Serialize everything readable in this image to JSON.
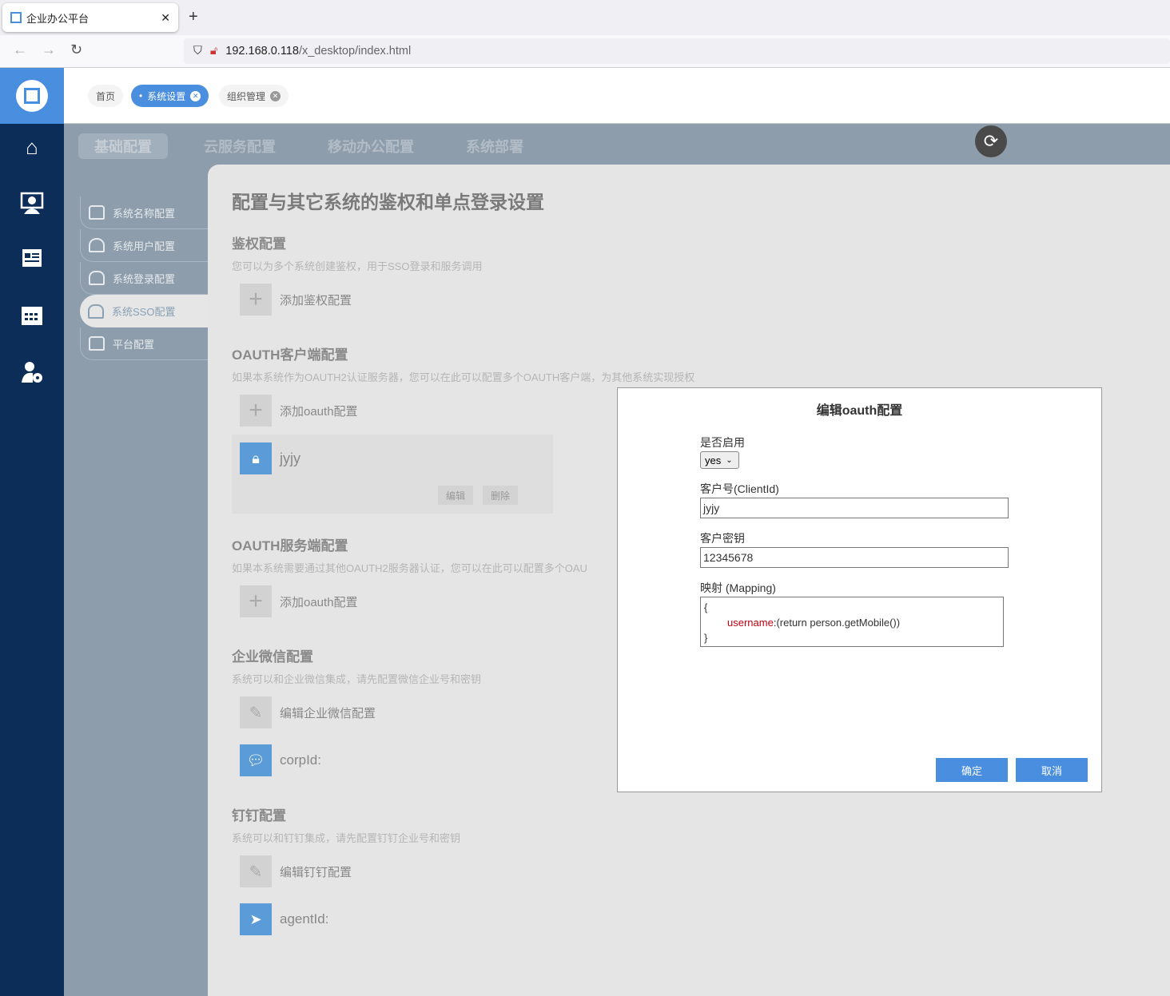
{
  "browser": {
    "tab_title": "企业办公平台",
    "url_host": "192.168.0.118",
    "url_path": "/x_desktop/index.html"
  },
  "header": {
    "tabs": [
      {
        "label": "首页"
      },
      {
        "label": "系统设置"
      },
      {
        "label": "组织管理"
      }
    ]
  },
  "leftnav": {
    "icons": [
      "home-icon",
      "user-monitor-icon",
      "news-icon",
      "calendar-icon",
      "user-settings-icon"
    ]
  },
  "top_tabs": [
    {
      "label": "基础配置"
    },
    {
      "label": "云服务配置"
    },
    {
      "label": "移动办公配置"
    },
    {
      "label": "系统部署"
    }
  ],
  "submenu": [
    {
      "label": "系统名称配置"
    },
    {
      "label": "系统用户配置"
    },
    {
      "label": "系统登录配置"
    },
    {
      "label": "系统SSO配置"
    },
    {
      "label": "平台配置"
    }
  ],
  "content": {
    "title": "配置与其它系统的鉴权和单点登录设置",
    "auth": {
      "heading": "鉴权配置",
      "desc": "您可以为多个系统创建鉴权，用于SSO登录和服务调用",
      "add": "添加鉴权配置"
    },
    "oauth_client": {
      "heading": "OAUTH客户端配置",
      "desc": "如果本系统作为OAUTH2认证服务器，您可以在此可以配置多个OAUTH客户端，为其他系统实现授权",
      "add": "添加oauth配置",
      "item_name": "jyjy",
      "edit": "编辑",
      "delete": "删除"
    },
    "oauth_server": {
      "heading": "OAUTH服务端配置",
      "desc": "如果本系统需要通过其他OAUTH2服务器认证，您可以在此可以配置多个OAU",
      "add": "添加oauth配置"
    },
    "wechat": {
      "heading": "企业微信配置",
      "desc": "系统可以和企业微信集成，请先配置微信企业号和密钥",
      "edit": "编辑企业微信配置",
      "corp": "corpId:"
    },
    "dingtalk": {
      "heading": "钉钉配置",
      "desc": "系统可以和钉钉集成，请先配置钉钉企业号和密钥",
      "edit": "编辑钉钉配置",
      "agent": "agentId:"
    }
  },
  "dialog": {
    "title": "编辑oauth配置",
    "enable_label": "是否启用",
    "enable_value": "yes",
    "client_id_label": "客户号(ClientId)",
    "client_id_value": "jyjy",
    "secret_label": "客户密钥",
    "secret_value": "12345678",
    "mapping_label": "映射 (Mapping)",
    "mapping_open": "{",
    "mapping_key": "username",
    "mapping_colon": ":",
    "mapping_value": "(return person.getMobile())",
    "mapping_close": "}",
    "ok": "确定",
    "cancel": "取消"
  },
  "colors": {
    "accent": "#4a8fdf",
    "nav": "#0b2d57",
    "mapping_key": "#c00010"
  }
}
